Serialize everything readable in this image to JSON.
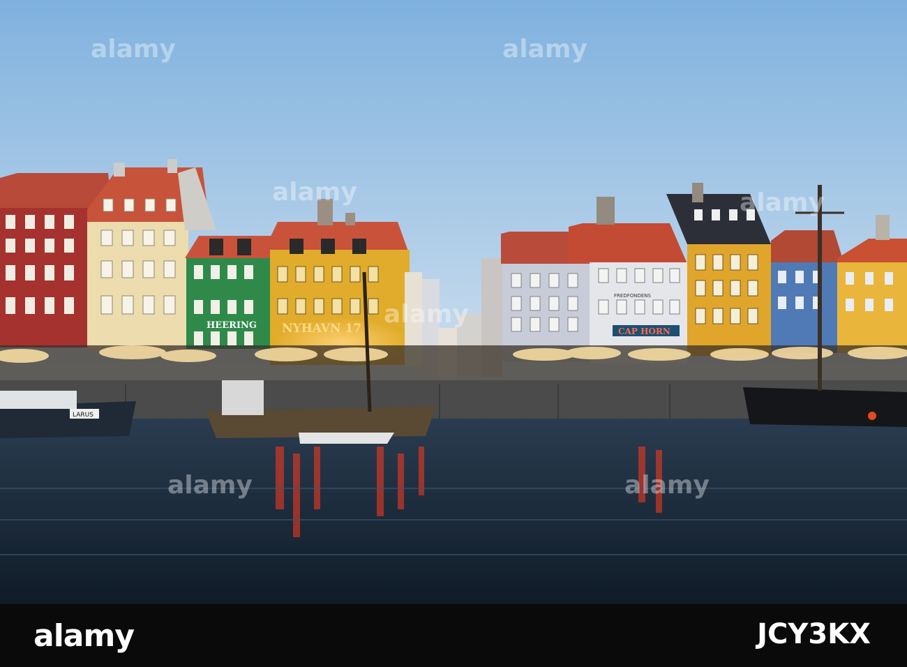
{
  "photo": {
    "signs": {
      "heering": "HEERING",
      "nyhavn": "NYHAVN 17",
      "cap_horn": "CAP HORN",
      "fredfondens": "FREDFONDENS",
      "boat_name": "LARUS"
    },
    "colors": {
      "sky_top": "#7fb1de",
      "sky_bottom": "#c9def0",
      "water": "#1b2c3c",
      "reflection": "#ff3a1e"
    }
  },
  "watermark": {
    "text": "alamy",
    "brand": "alamy",
    "reference_code": "JCY3KX"
  }
}
